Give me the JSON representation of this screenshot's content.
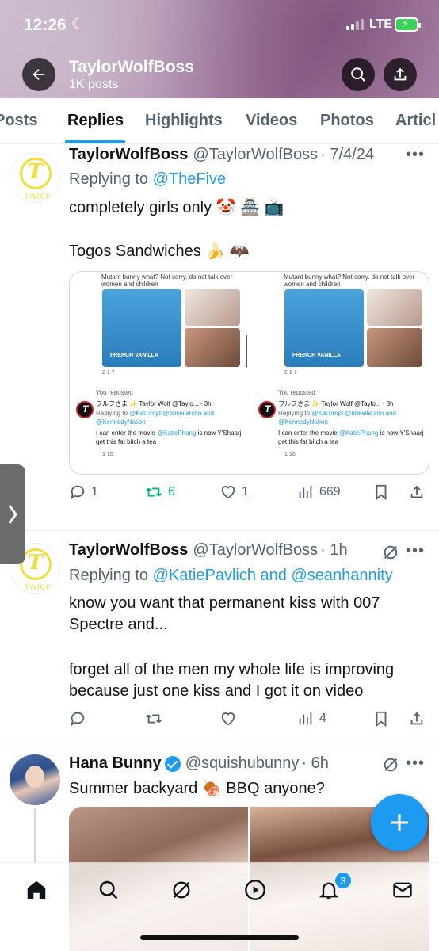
{
  "status_bar": {
    "time": "12:26",
    "network": "LTE"
  },
  "profile": {
    "name": "TaylorWolfBoss",
    "posts": "1K posts"
  },
  "tabs": [
    {
      "label": "Posts"
    },
    {
      "label": "Replies"
    },
    {
      "label": "Highlights"
    },
    {
      "label": "Videos"
    },
    {
      "label": "Photos"
    },
    {
      "label": "Articl"
    }
  ],
  "tweets": [
    {
      "name": "TaylorWolfBoss",
      "handle": "@TaylorWolfBoss",
      "time": "· 7/4/24",
      "replying_label": "Replying to",
      "replying_to": "@TheFive",
      "line1": "completely girls only 🤡 🏯 📺",
      "line2": "Togos Sandwiches 🍌 🦇",
      "counts": {
        "replies": "1",
        "reposts": "6",
        "likes": "1",
        "views": "669"
      },
      "embed": {
        "caption": "Mutant bunny what? Not sorry. do not talk over women and children",
        "product": "FRENCH VANILLA",
        "mini_stats": "2   1   7",
        "reposted": "You reposted",
        "rp_name": "ヲルフさま ✨ Taylor Wolf @Taylo... · 3h",
        "rp_reply_label": "Replying to ",
        "rp_reply_to": "@KatTimpf @brikeilarcnn and @KennedyNation",
        "rp_text_a": "I can enter the movie ",
        "rp_text_mention": "@KatiePhang",
        "rp_text_b": " is now Y'Shaarj get this fat bitch a tea",
        "mini_stats2": "1   10"
      }
    },
    {
      "name": "TaylorWolfBoss",
      "handle": "@TaylorWolfBoss",
      "time": "· 1h",
      "replying_label": "Replying to",
      "replying_to": "@KatiePavlich and @seanhannity",
      "line1": "know you want that permanent kiss with 007 Spectre and...",
      "line2": "forget all of the men my whole life is improving because just one kiss and I got it on video",
      "counts": {
        "views": "4"
      }
    },
    {
      "name": "Hana Bunny",
      "handle": "@squishubunny",
      "time": "· 6h",
      "text": "Summer backyard 🍖 BBQ anyone?"
    }
  ],
  "nav": {
    "notifications_badge": "3"
  },
  "colors": {
    "accent": "#1d9bf0",
    "repost_green": "#00ba7c",
    "twice_yellow": "#f2de3b"
  }
}
